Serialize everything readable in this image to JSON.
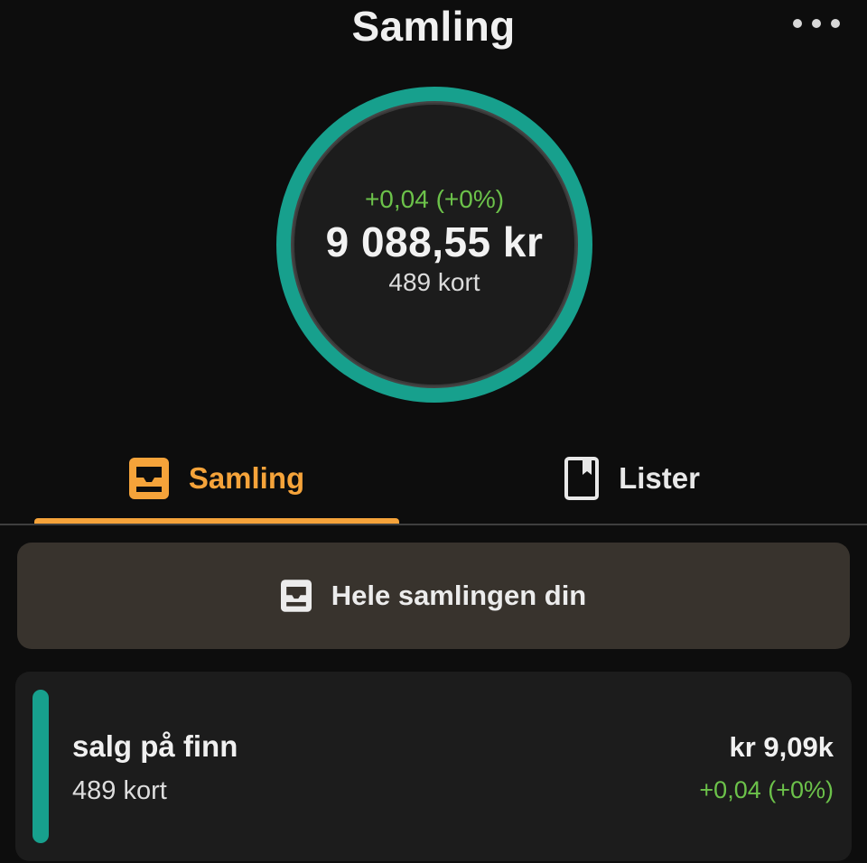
{
  "header": {
    "title": "Samling"
  },
  "summary": {
    "change": "+0,04 (+0%)",
    "value": "9 088,55 kr",
    "count": "489 kort",
    "ring_color": "#17a08d"
  },
  "tabs": [
    {
      "label": "Samling",
      "icon": "inbox-tray-icon",
      "active": true
    },
    {
      "label": "Lister",
      "icon": "bookmark-book-icon",
      "active": false
    }
  ],
  "whole_collection": {
    "label": "Hele samlingen din",
    "icon": "inbox-tray-icon"
  },
  "collections": [
    {
      "name": "salg på finn",
      "count": "489 kort",
      "value": "kr 9,09k",
      "change": "+0,04 (+0%)",
      "color": "#17a08d"
    }
  ],
  "colors": {
    "accent": "#f5a33a",
    "positive": "#6cc24a",
    "teal": "#17a08d",
    "background": "#0d0d0d"
  }
}
